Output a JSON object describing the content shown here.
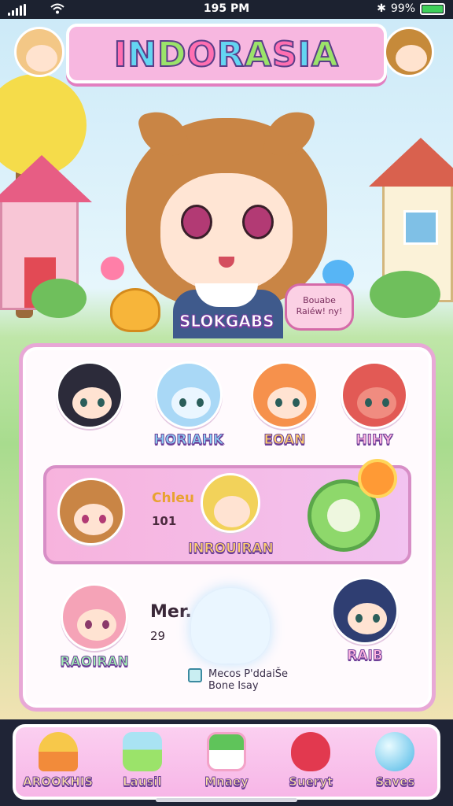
{
  "status_bar": {
    "time": "195 PM",
    "battery": "99%",
    "battery_level": 0.99
  },
  "app": {
    "title": "INDORASIA"
  },
  "hero": {
    "label": "SLOKGABS",
    "bubble_line1": "Bouabe",
    "bubble_line2": "Raiéw! ny!"
  },
  "characters": [
    {
      "name": "HORIAHK",
      "color": "blue"
    },
    {
      "name": "EOAN",
      "color": "orange"
    },
    {
      "name": "HIHY",
      "color": "pink"
    }
  ],
  "featured": {
    "title": "Chleu",
    "number": "101",
    "name": "INROUIRAN"
  },
  "info": {
    "title": "Mer..",
    "number": "29",
    "note_line1": "Mecos P'ddaiŠe",
    "note_line2": "Bone Isay"
  },
  "bottom_characters": [
    {
      "name": "RAOIRAN",
      "color": "green"
    },
    {
      "name": "RAIB",
      "color": "pink"
    }
  ],
  "nav": [
    {
      "label": "AROOKHIS",
      "icon": "cake-icon"
    },
    {
      "label": "Lausil",
      "icon": "drink-icon"
    },
    {
      "label": "Mnaey",
      "icon": "matcha-icon"
    },
    {
      "label": "Sueryt",
      "icon": "strawberry-icon"
    },
    {
      "label": "Saves",
      "icon": "orb-icon"
    }
  ]
}
